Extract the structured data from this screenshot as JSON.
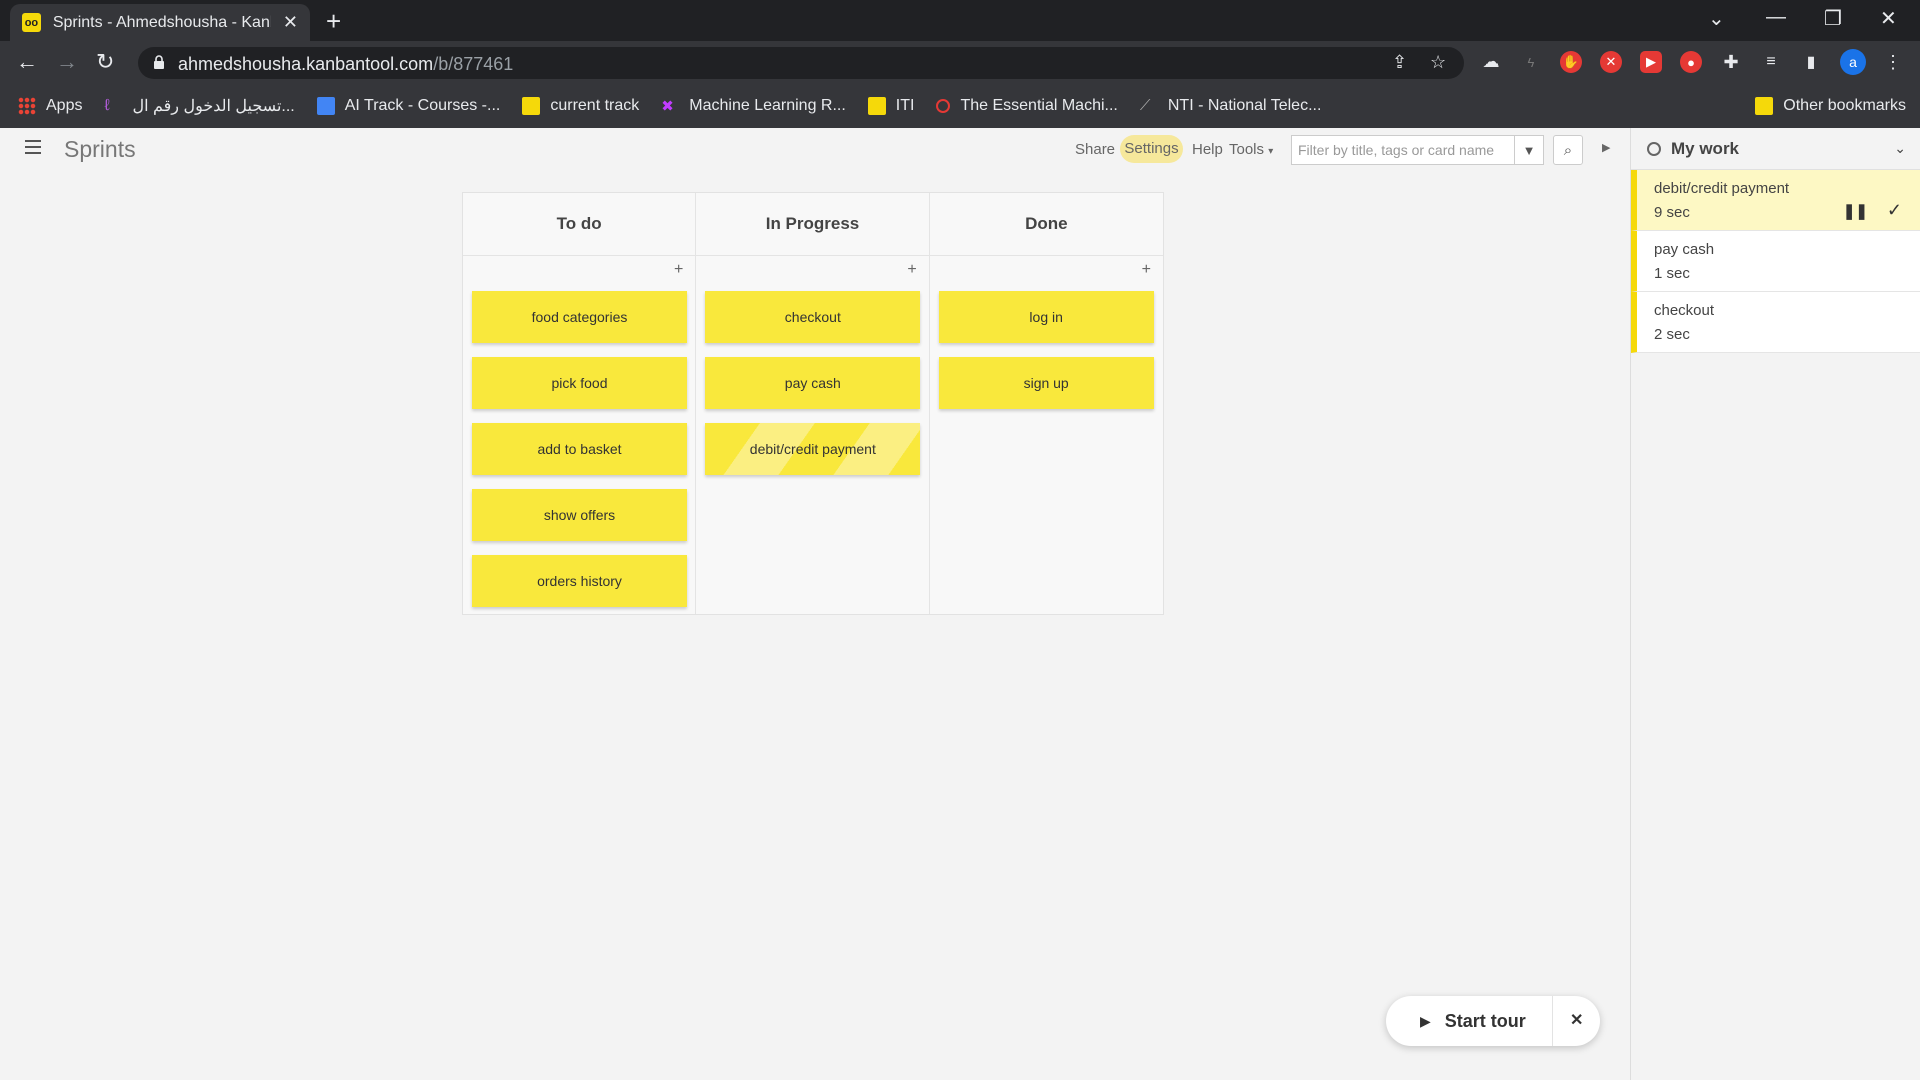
{
  "browser": {
    "tab_title": "Sprints - Ahmedshousha - Kanba",
    "url_host": "ahmedshousha.kanbantool.com",
    "url_path": "/b/877461",
    "avatar_letter": "a",
    "bookmarks": [
      {
        "label": "Apps",
        "icon": "apps-grid-icon"
      },
      {
        "label": "تسجيل الدخول رقم ال...",
        "icon": "bookmark-logo-icon"
      },
      {
        "label": "AI Track - Courses -...",
        "icon": "doc-icon"
      },
      {
        "label": "current track",
        "icon": "folder-icon"
      },
      {
        "label": "Machine Learning R...",
        "icon": "ml-icon"
      },
      {
        "label": "ITI",
        "icon": "folder-icon"
      },
      {
        "label": "The Essential Machi...",
        "icon": "ring-icon"
      },
      {
        "label": "NTI - National Telec...",
        "icon": "nti-icon"
      }
    ],
    "other_bookmarks": "Other bookmarks"
  },
  "app": {
    "board_title": "Sprints",
    "share": "Share",
    "settings": "Settings",
    "help": "Help",
    "tools": "Tools",
    "filter_placeholder": "Filter by title, tags or card name"
  },
  "columns": [
    {
      "title": "To do",
      "cards": [
        "food categories",
        "pick food",
        "add to basket",
        "show offers",
        "orders history"
      ]
    },
    {
      "title": "In Progress",
      "cards": [
        "checkout",
        "pay cash",
        "debit/credit payment"
      ]
    },
    {
      "title": "Done",
      "cards": [
        "log in",
        "sign up"
      ]
    }
  ],
  "sidebar": {
    "title": "My work",
    "items": [
      {
        "name": "debit/credit payment",
        "time": "9 sec"
      },
      {
        "name": "pay cash",
        "time": "1 sec"
      },
      {
        "name": "checkout",
        "time": "2 sec"
      }
    ]
  },
  "tour": {
    "label": "Start tour"
  },
  "colors": {
    "card": "#f9e83c",
    "accent": "#f5d90a"
  }
}
